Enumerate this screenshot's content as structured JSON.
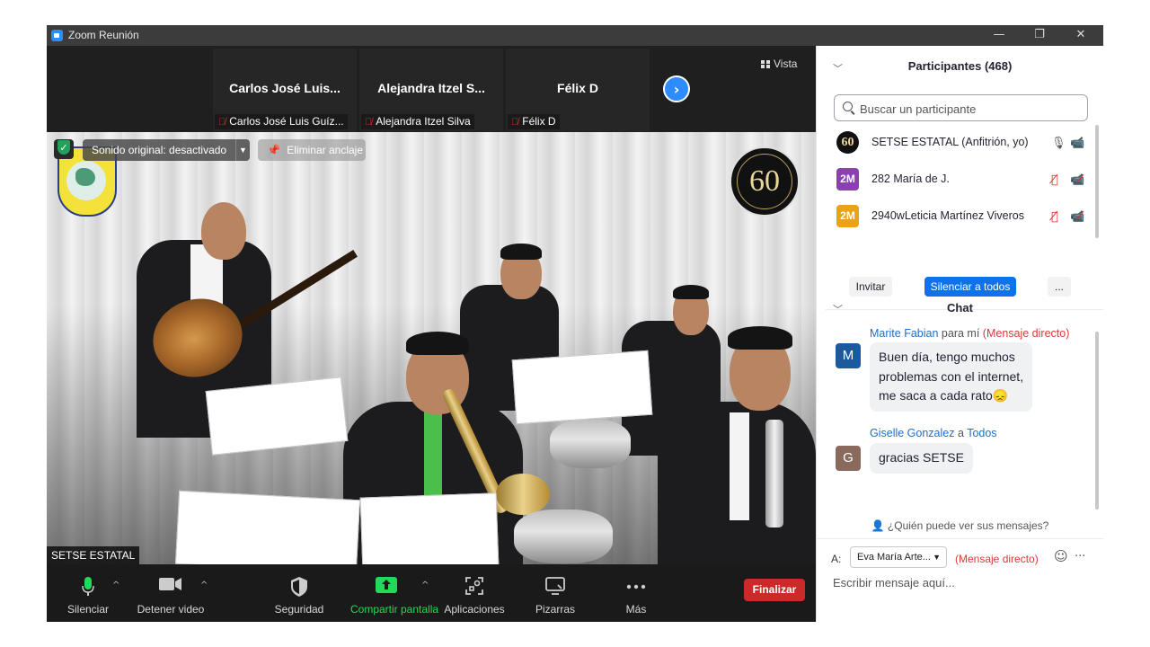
{
  "window": {
    "title": "Zoom Reunión",
    "minimize_glyph": "—",
    "restore_glyph": "❐",
    "close_glyph": "✕"
  },
  "strip": {
    "tiles": [
      {
        "name": "Carlos José Luis...",
        "footer": "Carlos José Luis Guíz..."
      },
      {
        "name": "Alejandra  Itzel S...",
        "footer": "Alejandra Itzel Silva"
      },
      {
        "name": "Félix D",
        "footer": "Félix D"
      }
    ],
    "next_glyph": "›",
    "view_label": "Vista"
  },
  "video": {
    "sound_original": "Sonido original: desactivado",
    "unpin": "Eliminar anclaje",
    "logo_number": "60",
    "speaker_name": "SETSE ESTATAL"
  },
  "toolbar": {
    "items": [
      {
        "label": "Silenciar",
        "icon": "microphone-icon"
      },
      {
        "label": "Detener video",
        "icon": "video-camera-icon"
      },
      {
        "label": "Seguridad",
        "icon": "shield-icon"
      },
      {
        "label": "Compartir pantalla",
        "icon": "share-screen-icon"
      },
      {
        "label": "Aplicaciones",
        "icon": "apps-icon"
      },
      {
        "label": "Pizarras",
        "icon": "whiteboard-icon"
      },
      {
        "label": "Más",
        "icon": "more-icon"
      }
    ],
    "end_label": "Finalizar",
    "caret_glyph": "^"
  },
  "participants": {
    "title": "Participantes (468)",
    "search_placeholder": "Buscar un participante",
    "list": [
      {
        "avatar": "60",
        "name": "SETSE ESTATAL (Anfitrión, yo)",
        "avatar_color": "#111111",
        "muted": false
      },
      {
        "avatar": "2M",
        "name": "282 María de J.",
        "avatar_color": "#8c3fb5",
        "muted": true
      },
      {
        "avatar": "2M",
        "name": "2940wLeticia Martínez Viveros",
        "avatar_color": "#e8a317",
        "muted": true
      }
    ],
    "invite": "Invitar",
    "mute_all": "Silenciar a todos",
    "more": "..."
  },
  "chat": {
    "title": "Chat",
    "messages": [
      {
        "sender": "Marite Fabian",
        "to_word": "para mí",
        "to": "(Mensaje directo)",
        "avatar": "M",
        "avatar_color": "#1c5a9e",
        "lines": [
          "Buen día, tengo muchos",
          "problemas con el internet,",
          "me saca a cada rato"
        ],
        "emoji": "😞"
      },
      {
        "sender": "Giselle Gonzalez",
        "to_word": "a",
        "to": "Todos",
        "avatar": "G",
        "avatar_color": "#8a6a5c",
        "lines": [
          "gracias SETSE"
        ],
        "emoji": ""
      }
    ],
    "who_can_see": "¿Quién puede ver sus mensajes?",
    "to_label": "A:",
    "recipient": "Eva María Arte...",
    "direct_label": "(Mensaje directo)",
    "compose_placeholder": "Escribir mensaje aquí..."
  }
}
